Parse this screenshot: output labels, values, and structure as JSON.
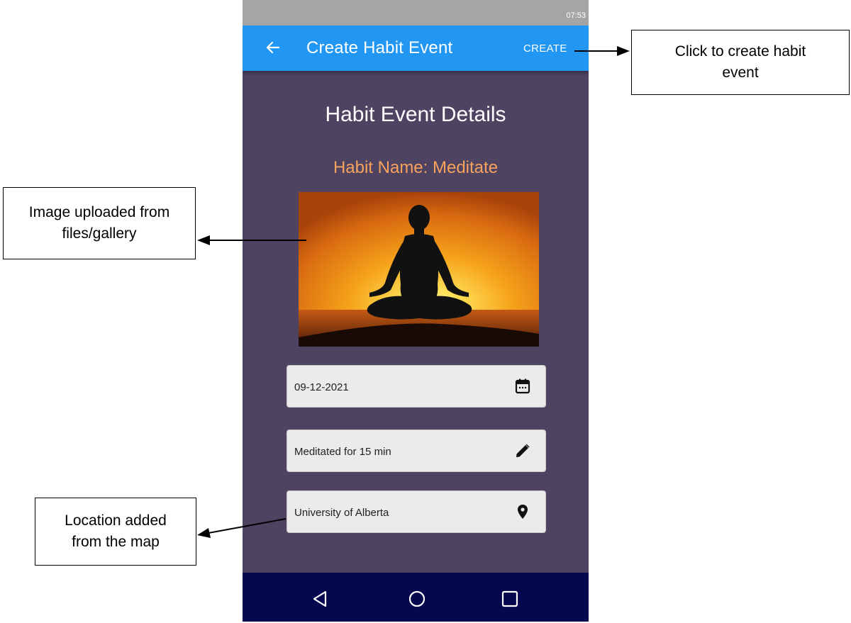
{
  "status_bar": {
    "time": "07:53"
  },
  "app_bar": {
    "back_icon": "arrow-back-icon",
    "title": "Create Habit Event",
    "create_label": "CREATE"
  },
  "details": {
    "heading": "Habit Event Details",
    "habit_name": "Habit Name: Meditate",
    "image": "meditation-silhouette-sunset"
  },
  "fields": {
    "date": {
      "value": "09-12-2021",
      "icon": "calendar-icon"
    },
    "comment": {
      "value": "Meditated for 15 min",
      "icon": "pencil-icon"
    },
    "location": {
      "value": "University of Alberta",
      "icon": "location-pin-icon"
    }
  },
  "nav_bar": {
    "back_icon": "nav-back-icon",
    "home_icon": "nav-home-icon",
    "recents_icon": "nav-recents-icon"
  },
  "annotations": {
    "create": "Click to create habit event",
    "image": "Image uploaded from files/gallery",
    "location": "Location added from the map"
  },
  "colors": {
    "app_bar": "#2196f3",
    "screen_bg": "#4f4362",
    "habit_name": "#f7a35c",
    "nav_bar": "#05084f"
  }
}
